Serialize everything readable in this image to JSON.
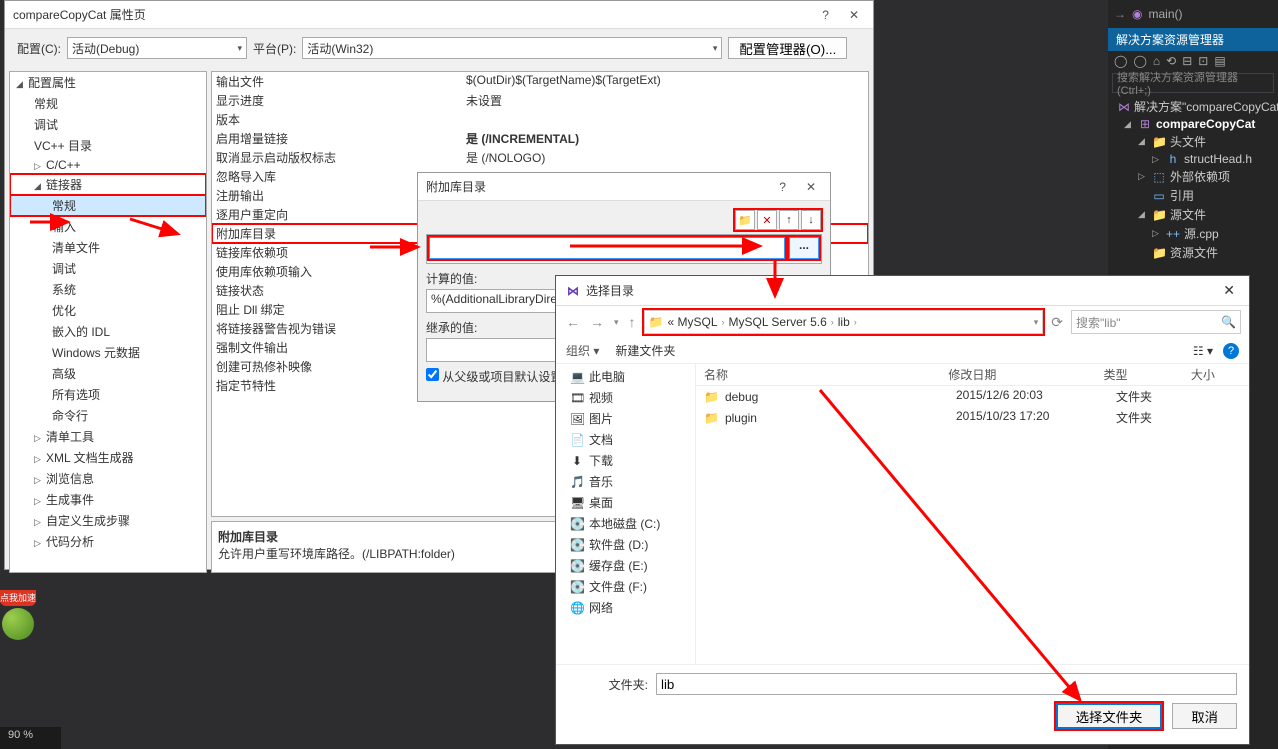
{
  "props": {
    "title": "compareCopyCat 属性页",
    "cfg_label": "配置(C):",
    "cfg_value": "活动(Debug)",
    "platform_label": "平台(P):",
    "platform_value": "活动(Win32)",
    "cfg_mgr": "配置管理器(O)...",
    "tree": {
      "root": "配置属性",
      "l1": [
        "常规",
        "调试",
        "VC++ 目录",
        "C/C++",
        "链接器"
      ],
      "linker": [
        "常规",
        "输入",
        "清单文件",
        "调试",
        "系统",
        "优化",
        "嵌入的 IDL",
        "Windows 元数据",
        "高级",
        "所有选项",
        "命令行"
      ],
      "after": [
        "清单工具",
        "XML 文档生成器",
        "浏览信息",
        "生成事件",
        "自定义生成步骤",
        "代码分析"
      ]
    },
    "grid": [
      {
        "k": "输出文件",
        "v": "$(OutDir)$(TargetName)$(TargetExt)"
      },
      {
        "k": "显示进度",
        "v": "未设置"
      },
      {
        "k": "版本",
        "v": ""
      },
      {
        "k": "启用增量链接",
        "v": "是 (/INCREMENTAL)",
        "b": true
      },
      {
        "k": "取消显示启动版权标志",
        "v": "是 (/NOLOGO)"
      },
      {
        "k": "忽略导入库",
        "v": ""
      },
      {
        "k": "注册输出",
        "v": ""
      },
      {
        "k": "逐用户重定向",
        "v": ""
      },
      {
        "k": "附加库目录",
        "v": ""
      },
      {
        "k": "链接库依赖项",
        "v": ""
      },
      {
        "k": "使用库依赖项输入",
        "v": ""
      },
      {
        "k": "链接状态",
        "v": ""
      },
      {
        "k": "阻止 Dll 绑定",
        "v": ""
      },
      {
        "k": "将链接器警告视为错误",
        "v": ""
      },
      {
        "k": "强制文件输出",
        "v": ""
      },
      {
        "k": "创建可热修补映像",
        "v": ""
      },
      {
        "k": "指定节特性",
        "v": ""
      }
    ],
    "desc_h": "附加库目录",
    "desc_t": "允许用户重写环境库路径。(/LIBPATH:folder)"
  },
  "libdlg": {
    "title": "附加库目录",
    "tb": [
      "new",
      "del",
      "up",
      "down"
    ],
    "dots": "...",
    "calc_label": "计算的值:",
    "calc_value": "%(AdditionalLibraryDirectories)",
    "inherit_label": "继承的值:",
    "chk": "从父级或项目默认设置继承(I)"
  },
  "seldlg": {
    "title": "选择目录",
    "crumb": [
      "«  MySQL",
      "MySQL Server 5.6",
      "lib"
    ],
    "search_ph": "搜索\"lib\"",
    "org": "组织",
    "newf": "新建文件夹",
    "cols": [
      "名称",
      "修改日期",
      "类型",
      "大小"
    ],
    "places": [
      {
        "ic": "💻",
        "t": "此电脑"
      },
      {
        "ic": "🎞",
        "t": "视频"
      },
      {
        "ic": "🖼",
        "t": "图片"
      },
      {
        "ic": "📄",
        "t": "文档"
      },
      {
        "ic": "⬇",
        "t": "下载"
      },
      {
        "ic": "🎵",
        "t": "音乐"
      },
      {
        "ic": "🖥",
        "t": "桌面"
      },
      {
        "ic": "💽",
        "t": "本地磁盘 (C:)"
      },
      {
        "ic": "💽",
        "t": "软件盘 (D:)"
      },
      {
        "ic": "💽",
        "t": "缓存盘 (E:)"
      },
      {
        "ic": "💽",
        "t": "文件盘 (F:)"
      },
      {
        "ic": "🌐",
        "t": "网络"
      }
    ],
    "files": [
      {
        "n": "debug",
        "d": "2015/12/6 20:03",
        "t": "文件夹"
      },
      {
        "n": "plugin",
        "d": "2015/10/23 17:20",
        "t": "文件夹"
      }
    ],
    "folder_label": "文件夹:",
    "folder_value": "lib",
    "btn_ok": "选择文件夹",
    "btn_cancel": "取消"
  },
  "se": {
    "main": "main()",
    "title": "解决方案资源管理器",
    "search_ph": "搜索解决方案资源管理器(Ctrl+;)",
    "sol": "解决方案\"compareCopyCat\"",
    "proj": "compareCopyCat",
    "hdr": "头文件",
    "hfile": "structHead.h",
    "ext": "外部依赖项",
    "ref": "引用",
    "src": "源文件",
    "cpp": "源.cpp",
    "res": "资源文件"
  },
  "bottom": {
    "zoom": "90 %"
  }
}
